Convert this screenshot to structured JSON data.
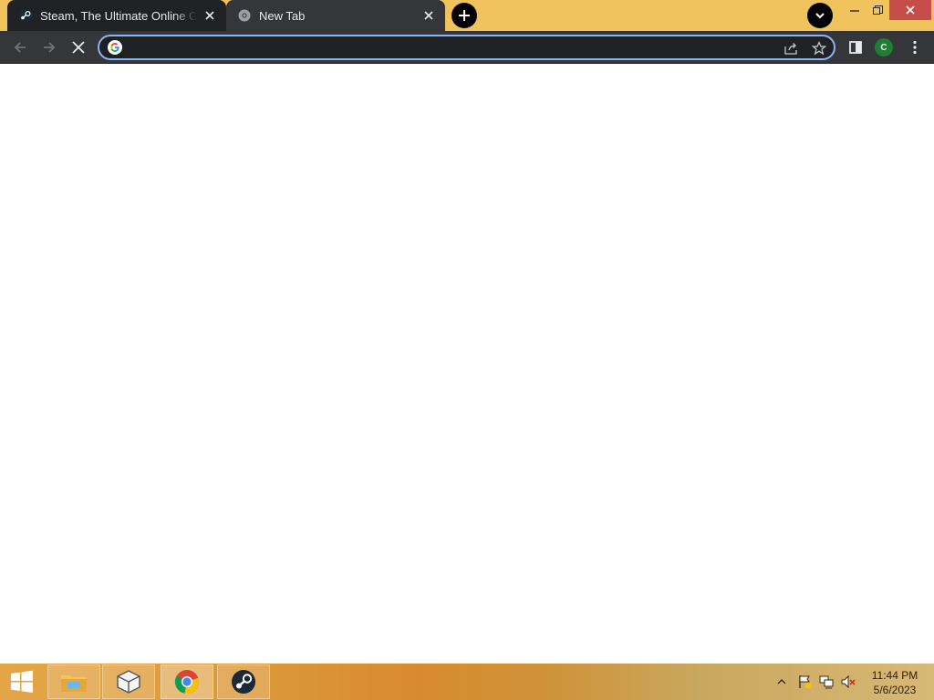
{
  "browser": {
    "tabs": [
      {
        "title": "Steam, The Ultimate Online Game Platform",
        "favicon": "steam-icon",
        "active": true
      },
      {
        "title": "New Tab",
        "favicon": "chrome-newtab-icon",
        "active": false
      }
    ],
    "toolbar": {
      "address_value": "",
      "profile_initial": "C"
    }
  },
  "taskbar": {
    "apps": [
      {
        "name": "file-explorer-icon"
      },
      {
        "name": "app-box-icon"
      },
      {
        "name": "chrome-icon"
      },
      {
        "name": "steam-icon"
      }
    ],
    "clock": {
      "time": "11:44 PM",
      "date": "5/6/2023"
    }
  },
  "colors": {
    "tabstrip": "#f1c35c",
    "toolbar": "#35363a",
    "omnibox_focus": "#8ab4f8",
    "taskbar": "#d88b2e"
  }
}
